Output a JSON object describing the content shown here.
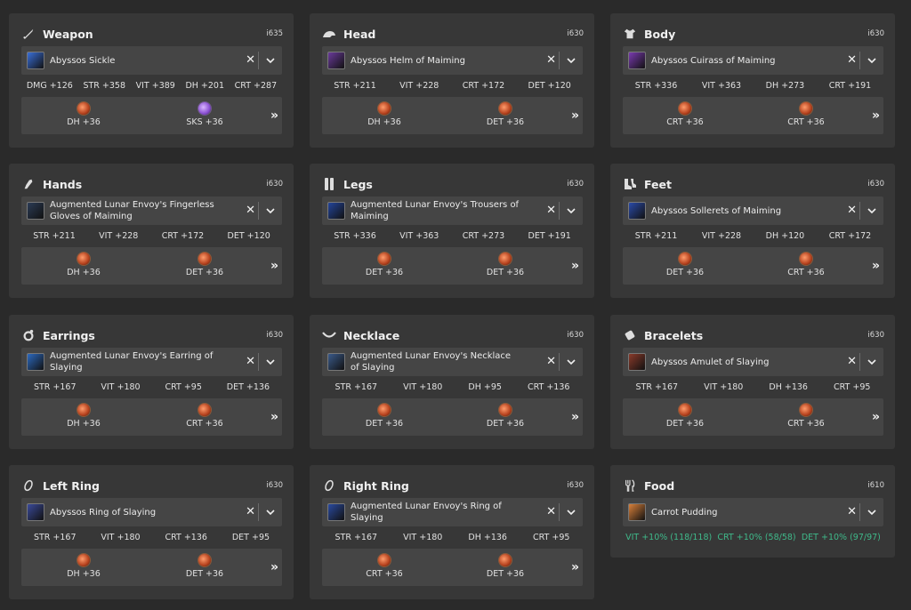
{
  "colors": {
    "background": "#2a2a2a",
    "card": "#373737",
    "field": "#454545",
    "food_stat": "#3fb98a"
  },
  "slots": [
    {
      "key": "weapon",
      "name": "Weapon",
      "icon": "sword-icon",
      "ilvl": "i635",
      "item": "Abyssos Sickle",
      "item_color": "#3a6fd8",
      "stats": [
        "DMG +126",
        "STR +358",
        "VIT +389",
        "DH +201",
        "CRT +287"
      ],
      "melds": [
        {
          "label": "DH +36",
          "kind": "a"
        },
        {
          "label": "SKS +36",
          "kind": "b"
        }
      ]
    },
    {
      "key": "head",
      "name": "Head",
      "icon": "helmet-icon",
      "ilvl": "i630",
      "item": "Abyssos Helm of Maiming",
      "item_color": "#6a3a9a",
      "stats": [
        "STR +211",
        "VIT +228",
        "CRT +172",
        "DET +120"
      ],
      "melds": [
        {
          "label": "DH +36",
          "kind": "a"
        },
        {
          "label": "DET +36",
          "kind": "a"
        }
      ]
    },
    {
      "key": "body",
      "name": "Body",
      "icon": "cuirass-icon",
      "ilvl": "i630",
      "item": "Abyssos Cuirass of Maiming",
      "item_color": "#7a3ab0",
      "stats": [
        "STR +336",
        "VIT +363",
        "DH +273",
        "CRT +191"
      ],
      "melds": [
        {
          "label": "CRT +36",
          "kind": "a"
        },
        {
          "label": "CRT +36",
          "kind": "a"
        }
      ]
    },
    {
      "key": "hands",
      "name": "Hands",
      "icon": "gauntlet-icon",
      "ilvl": "i630",
      "item": "Augmented Lunar Envoy's Fingerless Gloves of Maiming",
      "item_color": "#2b3b55",
      "stats": [
        "STR +211",
        "VIT +228",
        "CRT +172",
        "DET +120"
      ],
      "melds": [
        {
          "label": "DH +36",
          "kind": "a"
        },
        {
          "label": "DET +36",
          "kind": "a"
        }
      ]
    },
    {
      "key": "legs",
      "name": "Legs",
      "icon": "legs-icon",
      "ilvl": "i630",
      "item": "Augmented Lunar Envoy's Trousers of Maiming",
      "item_color": "#23449a",
      "stats": [
        "STR +336",
        "VIT +363",
        "CRT +273",
        "DET +191"
      ],
      "melds": [
        {
          "label": "DET +36",
          "kind": "a"
        },
        {
          "label": "DET +36",
          "kind": "a"
        }
      ]
    },
    {
      "key": "feet",
      "name": "Feet",
      "icon": "boots-icon",
      "ilvl": "i630",
      "item": "Abyssos Sollerets of Maiming",
      "item_color": "#2a4aa8",
      "stats": [
        "STR +211",
        "VIT +228",
        "DH +120",
        "CRT +172"
      ],
      "melds": [
        {
          "label": "DET +36",
          "kind": "a"
        },
        {
          "label": "CRT +36",
          "kind": "a"
        }
      ]
    },
    {
      "key": "earrings",
      "name": "Earrings",
      "icon": "earring-icon",
      "ilvl": "i630",
      "item": "Augmented Lunar Envoy's Earring of Slaying",
      "item_color": "#2c6ac0",
      "stats": [
        "STR +167",
        "VIT +180",
        "CRT +95",
        "DET +136"
      ],
      "melds": [
        {
          "label": "DH +36",
          "kind": "a"
        },
        {
          "label": "CRT +36",
          "kind": "a"
        }
      ]
    },
    {
      "key": "necklace",
      "name": "Necklace",
      "icon": "necklace-icon",
      "ilvl": "i630",
      "item": "Augmented Lunar Envoy's Necklace of Slaying",
      "item_color": "#3a5a8a",
      "stats": [
        "STR +167",
        "VIT +180",
        "DH +95",
        "CRT +136"
      ],
      "melds": [
        {
          "label": "DET +36",
          "kind": "a"
        },
        {
          "label": "DET +36",
          "kind": "a"
        }
      ]
    },
    {
      "key": "bracelets",
      "name": "Bracelets",
      "icon": "bracelet-icon",
      "ilvl": "i630",
      "item": "Abyssos Amulet of Slaying",
      "item_color": "#8a3a2a",
      "stats": [
        "STR +167",
        "VIT +180",
        "DH +136",
        "CRT +95"
      ],
      "melds": [
        {
          "label": "DET +36",
          "kind": "a"
        },
        {
          "label": "CRT +36",
          "kind": "a"
        }
      ]
    },
    {
      "key": "left_ring",
      "name": "Left Ring",
      "icon": "ring-icon",
      "ilvl": "i630",
      "item": "Abyssos Ring of Slaying",
      "item_color": "#3a4a9a",
      "stats": [
        "STR +167",
        "VIT +180",
        "CRT +136",
        "DET +95"
      ],
      "melds": [
        {
          "label": "DH +36",
          "kind": "a"
        },
        {
          "label": "DET +36",
          "kind": "a"
        }
      ]
    },
    {
      "key": "right_ring",
      "name": "Right Ring",
      "icon": "ring-icon",
      "ilvl": "i630",
      "item": "Augmented Lunar Envoy's Ring of Slaying",
      "item_color": "#2a4aa0",
      "stats": [
        "STR +167",
        "VIT +180",
        "DH +136",
        "CRT +95"
      ],
      "melds": [
        {
          "label": "CRT +36",
          "kind": "a"
        },
        {
          "label": "DET +36",
          "kind": "a"
        }
      ]
    },
    {
      "key": "food",
      "name": "Food",
      "icon": "fork-knife-icon",
      "ilvl": "i610",
      "item": "Carrot Pudding",
      "item_color": "#d8803a",
      "stats": [
        "VIT +10% (118/118)",
        "CRT +10% (58/58)",
        "DET +10% (97/97)"
      ],
      "melds": []
    }
  ],
  "ui": {
    "clear": "✕",
    "more": "»"
  }
}
